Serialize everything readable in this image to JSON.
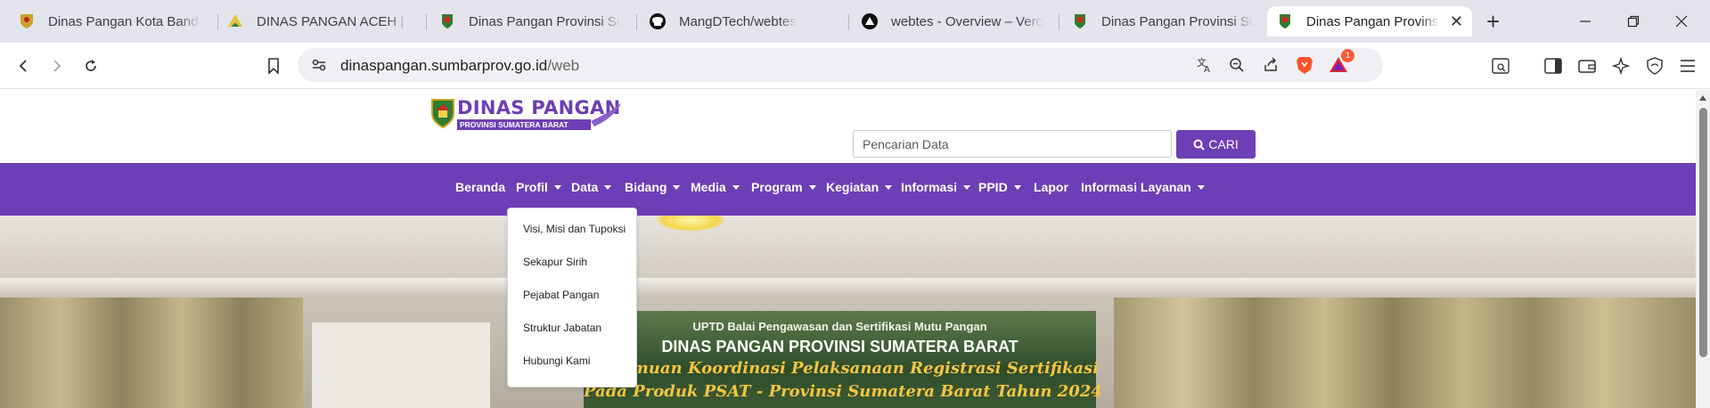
{
  "browser": {
    "tabs": [
      {
        "title": "Dinas Pangan Kota Bandar",
        "icon": "shield-crest-icon"
      },
      {
        "title": "DINAS PANGAN ACEH | W",
        "icon": "aceh-crest-icon"
      },
      {
        "title": "Dinas Pangan Provinsi Sum",
        "icon": "sumbar-crest-icon"
      },
      {
        "title": "MangDTech/webtes",
        "icon": "github-icon"
      },
      {
        "title": "webtes - Overview – Verce",
        "icon": "vercel-icon"
      },
      {
        "title": "Dinas Pangan Provinsi Sum",
        "icon": "sumbar-crest-icon"
      },
      {
        "title": "Dinas Pangan Provinsi",
        "icon": "sumbar-crest-icon"
      }
    ],
    "address": {
      "domain": "dinaspangan.sumbarprov.go.id",
      "path": "/web"
    },
    "notification_count": "1",
    "colors": {
      "tabstrip": "#e4e4ec",
      "brave_orange": "#fb542b"
    }
  },
  "site": {
    "logo": {
      "main": "DINAS PANGAN",
      "sub": "PROVINSI SUMATERA BARAT"
    },
    "search": {
      "placeholder": "Pencarian Data",
      "button": "CARI"
    },
    "nav": [
      {
        "label": "Beranda",
        "dropdown": false
      },
      {
        "label": "Profil",
        "dropdown": true
      },
      {
        "label": "Data",
        "dropdown": true
      },
      {
        "label": "Bidang",
        "dropdown": true
      },
      {
        "label": "Media",
        "dropdown": true
      },
      {
        "label": "Program",
        "dropdown": true
      },
      {
        "label": "Kegiatan",
        "dropdown": true
      },
      {
        "label": "Informasi",
        "dropdown": true
      },
      {
        "label": "PPID",
        "dropdown": true
      },
      {
        "label": "Lapor",
        "dropdown": false
      },
      {
        "label": "Informasi Layanan",
        "dropdown": true
      }
    ],
    "profil_menu": [
      "Visi, Misi dan Tupoksi",
      "Sekapur Sirih",
      "Pejabat Pangan",
      "Struktur Jabatan",
      "Hubungi Kami"
    ],
    "hero_banner": {
      "line1": "UPTD Balai Pengawasan dan Sertifikasi Mutu Pangan",
      "line2": "DINAS PANGAN PROVINSI SUMATERA BARAT",
      "line3": "Pertemuan Koordinasi Pelaksanaan Registrasi Sertifikasi",
      "line4": "Pada Produk PSAT - Provinsi Sumatera Barat Tahun 2024"
    },
    "colors": {
      "primary": "#6d3fb6"
    }
  }
}
